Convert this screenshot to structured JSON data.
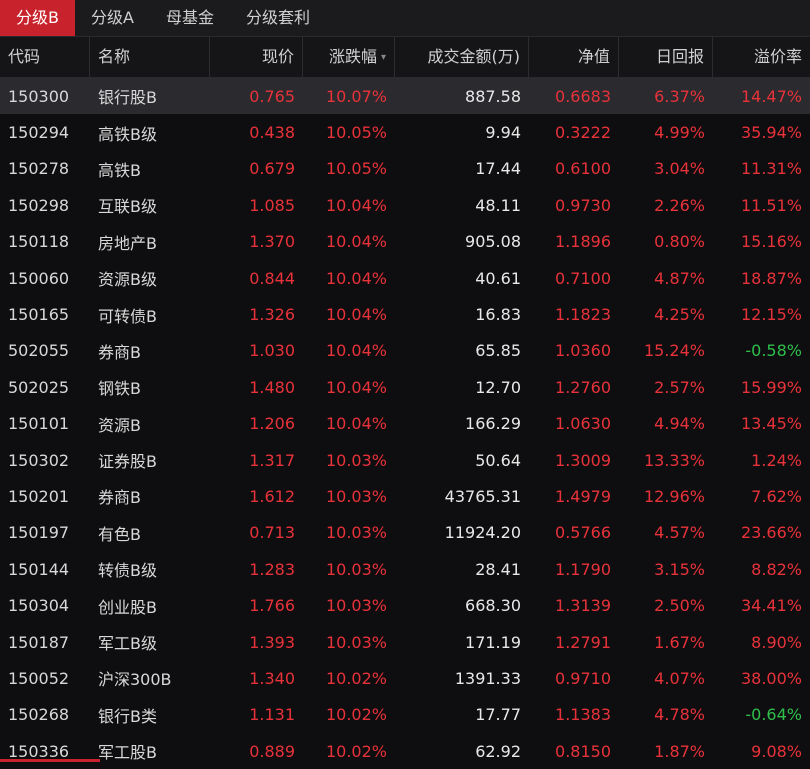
{
  "tabs": [
    "分级B",
    "分级A",
    "母基金",
    "分级套利"
  ],
  "active_tab": 0,
  "columns": [
    "代码",
    "名称",
    "现价",
    "涨跌幅",
    "成交金额(万)",
    "净值",
    "日回报",
    "溢价率"
  ],
  "sort_indicator": "▾",
  "colors": {
    "up": "#e8323a",
    "down": "#2fbf4a",
    "accent": "#c8232c"
  },
  "rows": [
    [
      "150300",
      "银行股B",
      "0.765",
      "10.07%",
      "887.58",
      "0.6683",
      "6.37%",
      "14.47%"
    ],
    [
      "150294",
      "高铁B级",
      "0.438",
      "10.05%",
      "9.94",
      "0.3222",
      "4.99%",
      "35.94%"
    ],
    [
      "150278",
      "高铁B",
      "0.679",
      "10.05%",
      "17.44",
      "0.6100",
      "3.04%",
      "11.31%"
    ],
    [
      "150298",
      "互联B级",
      "1.085",
      "10.04%",
      "48.11",
      "0.9730",
      "2.26%",
      "11.51%"
    ],
    [
      "150118",
      "房地产B",
      "1.370",
      "10.04%",
      "905.08",
      "1.1896",
      "0.80%",
      "15.16%"
    ],
    [
      "150060",
      "资源B级",
      "0.844",
      "10.04%",
      "40.61",
      "0.7100",
      "4.87%",
      "18.87%"
    ],
    [
      "150165",
      "可转债B",
      "1.326",
      "10.04%",
      "16.83",
      "1.1823",
      "4.25%",
      "12.15%"
    ],
    [
      "502055",
      "券商B",
      "1.030",
      "10.04%",
      "65.85",
      "1.0360",
      "15.24%",
      "-0.58%"
    ],
    [
      "502025",
      "钢铁B",
      "1.480",
      "10.04%",
      "12.70",
      "1.2760",
      "2.57%",
      "15.99%"
    ],
    [
      "150101",
      "资源B",
      "1.206",
      "10.04%",
      "166.29",
      "1.0630",
      "4.94%",
      "13.45%"
    ],
    [
      "150302",
      "证券股B",
      "1.317",
      "10.03%",
      "50.64",
      "1.3009",
      "13.33%",
      "1.24%"
    ],
    [
      "150201",
      "券商B",
      "1.612",
      "10.03%",
      "43765.31",
      "1.4979",
      "12.96%",
      "7.62%"
    ],
    [
      "150197",
      "有色B",
      "0.713",
      "10.03%",
      "11924.20",
      "0.5766",
      "4.57%",
      "23.66%"
    ],
    [
      "150144",
      "转债B级",
      "1.283",
      "10.03%",
      "28.41",
      "1.1790",
      "3.15%",
      "8.82%"
    ],
    [
      "150304",
      "创业股B",
      "1.766",
      "10.03%",
      "668.30",
      "1.3139",
      "2.50%",
      "34.41%"
    ],
    [
      "150187",
      "军工B级",
      "1.393",
      "10.03%",
      "171.19",
      "1.2791",
      "1.67%",
      "8.90%"
    ],
    [
      "150052",
      "沪深300B",
      "1.340",
      "10.02%",
      "1391.33",
      "0.9710",
      "4.07%",
      "38.00%"
    ],
    [
      "150268",
      "银行B类",
      "1.131",
      "10.02%",
      "17.77",
      "1.1383",
      "4.78%",
      "-0.64%"
    ],
    [
      "150336",
      "军工股B",
      "0.889",
      "10.02%",
      "62.92",
      "0.8150",
      "1.87%",
      "9.08%"
    ]
  ]
}
